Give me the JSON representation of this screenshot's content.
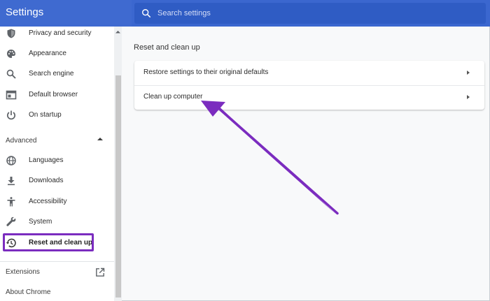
{
  "app": {
    "title": "Settings"
  },
  "search": {
    "placeholder": "Search settings"
  },
  "sidebar": {
    "items": [
      {
        "label": "Privacy and security",
        "icon": "shield-icon"
      },
      {
        "label": "Appearance",
        "icon": "palette-icon"
      },
      {
        "label": "Search engine",
        "icon": "search-icon"
      },
      {
        "label": "Default browser",
        "icon": "browser-icon"
      },
      {
        "label": "On startup",
        "icon": "power-icon"
      }
    ],
    "advanced_label": "Advanced",
    "advanced_items": [
      {
        "label": "Languages",
        "icon": "globe-icon"
      },
      {
        "label": "Downloads",
        "icon": "download-icon"
      },
      {
        "label": "Accessibility",
        "icon": "accessibility-icon"
      },
      {
        "label": "System",
        "icon": "wrench-icon"
      },
      {
        "label": "Reset and clean up",
        "icon": "restore-icon",
        "selected": true
      }
    ],
    "extensions_label": "Extensions",
    "about_label": "About Chrome"
  },
  "main": {
    "section_title": "Reset and clean up",
    "rows": [
      {
        "label": "Restore settings to their original defaults"
      },
      {
        "label": "Clean up computer"
      }
    ]
  },
  "colors": {
    "header": "#3b67cf",
    "search_bg": "#2f5cc4",
    "annotation": "#7b2cbf"
  }
}
